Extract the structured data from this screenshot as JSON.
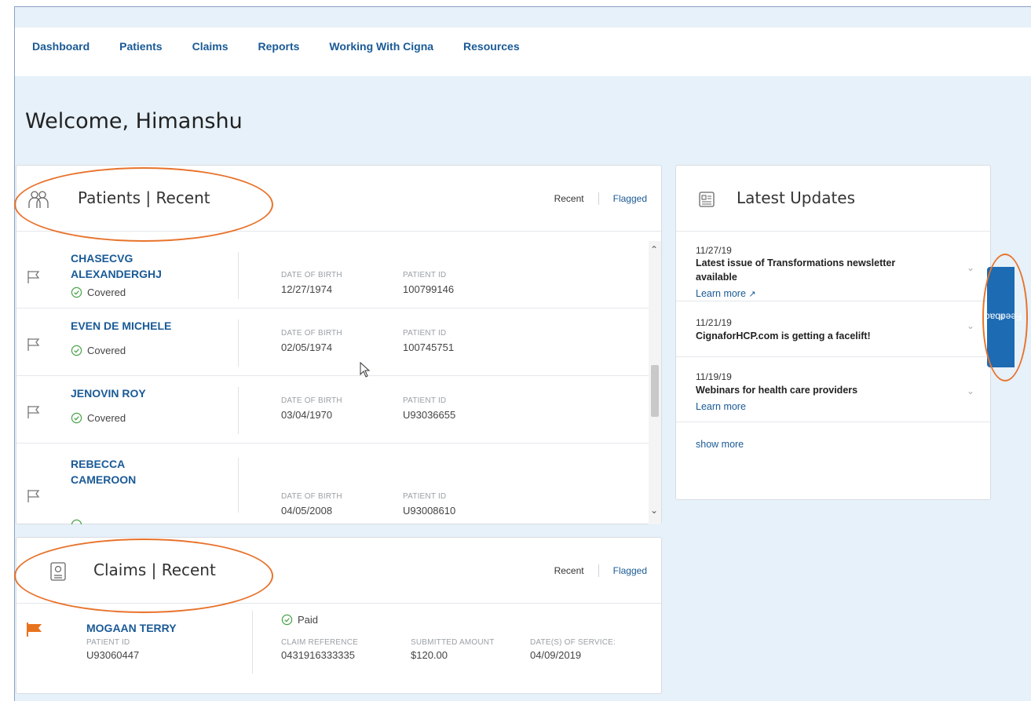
{
  "nav": {
    "items": [
      "Dashboard",
      "Patients",
      "Claims",
      "Reports",
      "Working With Cigna",
      "Resources"
    ]
  },
  "welcome": "Welcome, Himanshu",
  "patients": {
    "title": "Patients | Recent",
    "tab_recent": "Recent",
    "tab_flagged": "Flagged",
    "dob_label": "DATE OF BIRTH",
    "id_label": "PATIENT ID",
    "rows": [
      {
        "name_line1": "CHASECVG",
        "name_line2": "ALEXANDERGHJ",
        "status": "Covered",
        "dob": "12/27/1974",
        "patient_id": "100799146"
      },
      {
        "name_line1": "EVEN DE MICHELE",
        "name_line2": "",
        "status": "Covered",
        "dob": "02/05/1974",
        "patient_id": "100745751"
      },
      {
        "name_line1": "JENOVIN ROY",
        "name_line2": "",
        "status": "Covered",
        "dob": "03/04/1970",
        "patient_id": "U93036655"
      },
      {
        "name_line1": "REBECCA",
        "name_line2": "CAMEROON",
        "status": "",
        "dob": "04/05/2008",
        "patient_id": "U93008610"
      }
    ]
  },
  "claims": {
    "title": "Claims | Recent",
    "tab_recent": "Recent",
    "tab_flagged": "Flagged",
    "row": {
      "name": "MOGAAN TERRY",
      "patient_id_label": "PATIENT ID",
      "patient_id": "U93060447",
      "status": "Paid",
      "claim_ref_label": "CLAIM REFERENCE",
      "claim_ref": "0431916333335",
      "amount_label": "SUBMITTED AMOUNT",
      "amount": "$120.00",
      "dos_label": "DATE(S) OF SERVICE:",
      "dos": "04/09/2019"
    }
  },
  "updates": {
    "title": "Latest Updates",
    "items": [
      {
        "date": "11/27/19",
        "title": "Latest issue of Transformations newsletter available",
        "link": "Learn more"
      },
      {
        "date": "11/21/19",
        "title": "CignaforHCP.com is getting a facelift!",
        "link": ""
      },
      {
        "date": "11/19/19",
        "title": "Webinars for health care providers",
        "link": "Learn more"
      }
    ],
    "show_more": "show more"
  },
  "feedback": {
    "label": "Feedback"
  },
  "colors": {
    "accent": "#1a5a96",
    "flag": "#e8731e",
    "annotation": "#e8732c",
    "feedback_tab": "#1d6bb3"
  }
}
